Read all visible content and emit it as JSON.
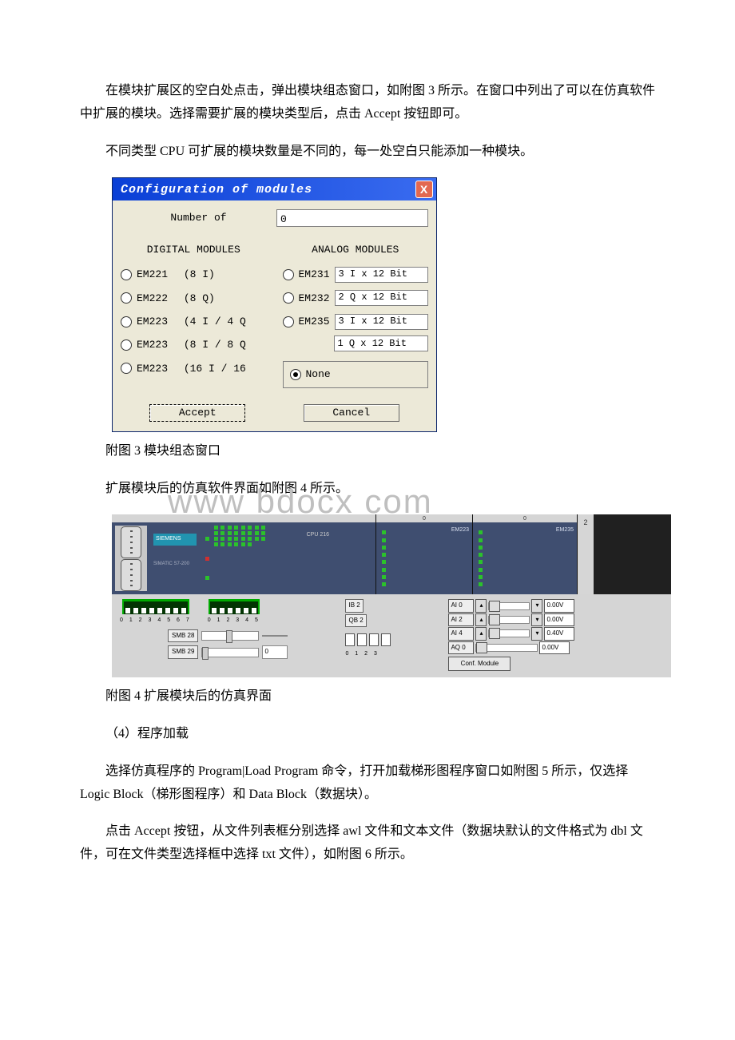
{
  "paragraphs": {
    "p1": "在模块扩展区的空白处点击，弹出模块组态窗口，如附图 3 所示。在窗口中列出了可以在仿真软件中扩展的模块。选择需要扩展的模块类型后，点击 Accept 按钮即可。",
    "p2": "不同类型 CPU 可扩展的模块数量是不同的，每一处空白只能添加一种模块。",
    "cap3": "附图 3 模块组态窗口",
    "p3": "扩展模块后的仿真软件界面如附图 4 所示。",
    "cap4": "附图 4 扩展模块后的仿真界面",
    "p4": "（4）程序加载",
    "p5": "选择仿真程序的 Program|Load Program 命令，打开加载梯形图程序窗口如附图 5 所示，仅选择 Logic Block（梯形图程序）和 Data Block（数据块）。",
    "p6": "点击 Accept 按钮，从文件列表框分别选择 awl 文件和文本文件（数据块默认的文件格式为 dbl 文件，可在文件类型选择框中选择 txt 文件），如附图 6 所示。"
  },
  "watermark": "www bdocx com",
  "dialog": {
    "title": "Configuration of modules",
    "close": "X",
    "number_label": "Number of",
    "number_value": "0",
    "digital_header": "DIGITAL MODULES",
    "analog_header": "ANALOG MODULES",
    "digital": [
      {
        "name": "EM221",
        "desc": "(8 I)"
      },
      {
        "name": "EM222",
        "desc": "(8 Q)"
      },
      {
        "name": "EM223",
        "desc": "(4 I /  4 Q"
      },
      {
        "name": "EM223",
        "desc": "(8 I /  8 Q"
      },
      {
        "name": "EM223",
        "desc": "(16 I / 16"
      }
    ],
    "analog": [
      {
        "name": "EM231",
        "desc": "3 I x 12 Bit"
      },
      {
        "name": "EM232",
        "desc": "2 Q x 12 Bit"
      },
      {
        "name": "EM235",
        "desc": "3 I x 12 Bit"
      },
      {
        "name": "",
        "desc": "1 Q x 12 Bit"
      }
    ],
    "none_label": "None",
    "accept": "Accept",
    "cancel": "Cancel"
  },
  "sim": {
    "brand": "SIEMENS",
    "family": "SIMATIC\nS7-200",
    "cpu": "CPU 216",
    "slots": [
      "0",
      "0",
      "2"
    ],
    "ext1_name": "EM223",
    "ext2_name": "EM235",
    "dip8_label": "0 1 2 3 4 5 6 7",
    "dip6_label": "0 1 2 3 4 5",
    "smb": [
      {
        "tag": "SMB 28",
        "val": ""
      },
      {
        "tag": "SMB 29",
        "val": "0"
      }
    ],
    "io_rows": [
      "IB 2",
      "QB 2"
    ],
    "sw_label": "0 1 2 3",
    "analog": [
      {
        "k": "AI 0",
        "v": "0.00V"
      },
      {
        "k": "AI 2",
        "v": "0.00V"
      },
      {
        "k": "AI 4",
        "v": "0.40V"
      },
      {
        "k": "AQ 0",
        "v": "0.00V"
      }
    ],
    "conf_btn": "Conf. Module"
  }
}
